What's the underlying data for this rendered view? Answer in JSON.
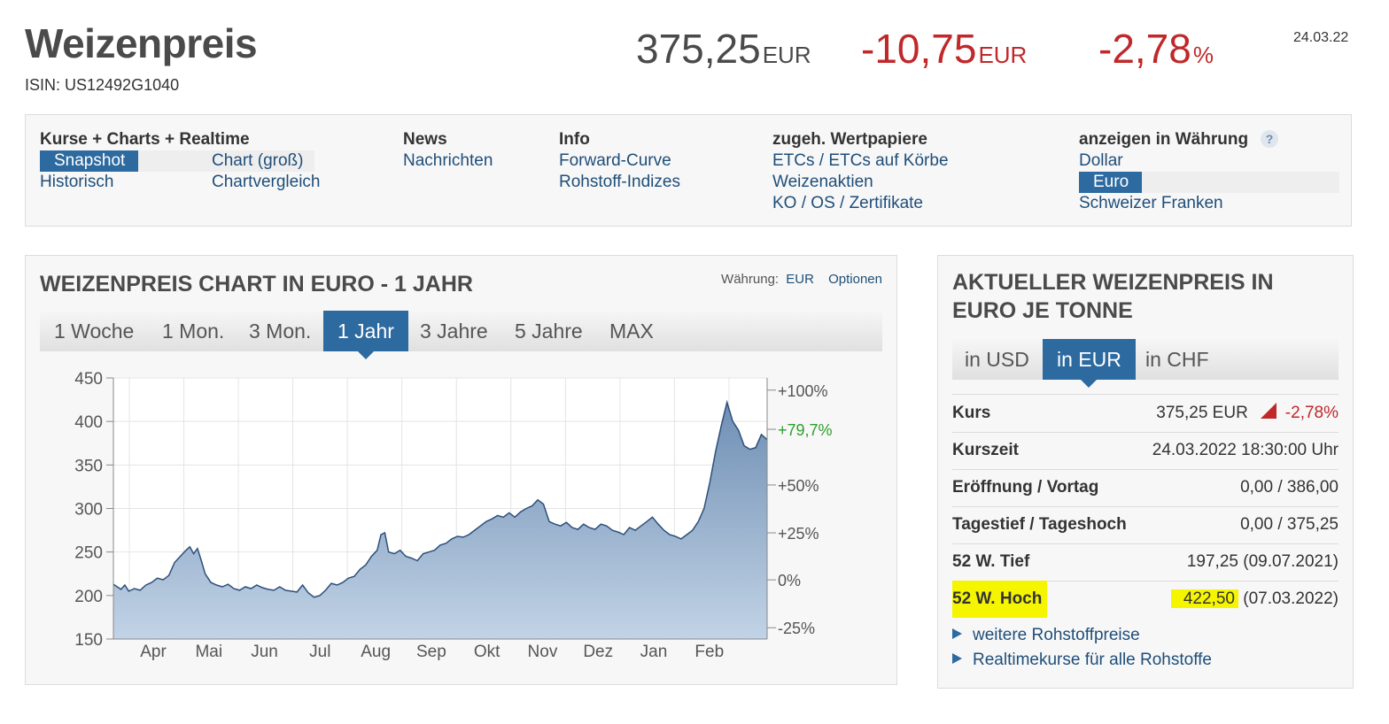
{
  "header": {
    "title": "Weizenpreis",
    "isin": "ISIN: US12492G1040",
    "price": "375,25",
    "price_unit": "EUR",
    "change_abs": "-10,75",
    "change_abs_unit": "EUR",
    "change_pct": "-2,78",
    "change_pct_unit": "%",
    "date": "24.03.22"
  },
  "nav": {
    "col1": {
      "heading": "Kurse + Charts + Realtime",
      "items": [
        "Snapshot",
        "Chart (groß)",
        "Historisch",
        "Chartvergleich"
      ]
    },
    "col2": {
      "heading": "News",
      "items": [
        "Nachrichten"
      ]
    },
    "col3": {
      "heading": "Info",
      "items": [
        "Forward-Curve",
        "Rohstoff-Indizes"
      ]
    },
    "col4": {
      "heading": "zugeh. Wertpapiere",
      "items": [
        "ETCs / ETCs auf Körbe",
        "Weizenaktien",
        "KO / OS / Zertifikate"
      ]
    },
    "col5": {
      "heading": "anzeigen in Währung",
      "help": "?",
      "items": [
        "Dollar",
        "Euro",
        "Schweizer Franken"
      ]
    }
  },
  "chart_panel": {
    "title": "WEIZENPREIS CHART IN EURO - 1 JAHR",
    "currency_label": "Währung:",
    "currency_value": "EUR",
    "options_label": "Optionen",
    "tabs": [
      "1 Woche",
      "1 Mon.",
      "3 Mon.",
      "1 Jahr",
      "3 Jahre",
      "5 Jahre",
      "MAX"
    ],
    "active_tab": "1 Jahr"
  },
  "chart_data": {
    "type": "area",
    "x_labels": [
      "Apr",
      "Mai",
      "Jun",
      "Jul",
      "Aug",
      "Sep",
      "Okt",
      "Nov",
      "Dez",
      "Jan",
      "Feb"
    ],
    "ylim": [
      150,
      450
    ],
    "yticks": [
      150,
      200,
      250,
      300,
      350,
      400,
      450
    ],
    "right_ticks": [
      {
        "label": "+100%",
        "value": 436
      },
      {
        "label": "+79,7%",
        "value": 391,
        "highlight": true
      },
      {
        "label": "+50%",
        "value": 327
      },
      {
        "label": "+25%",
        "value": 272
      },
      {
        "label": "0%",
        "value": 218
      },
      {
        "label": "-25%",
        "value": 163
      }
    ],
    "series": [
      {
        "x": [
          0,
          0.3,
          0.6,
          0.9,
          1.2,
          1.5,
          1.8,
          2.1,
          2.4,
          2.7,
          3.0,
          3.3,
          3.6,
          3.9,
          4.2,
          4.5,
          4.8,
          5.1,
          5.4,
          5.7,
          6.0,
          6.3,
          6.6,
          6.9,
          7.2,
          7.5,
          7.8,
          8.1,
          8.4,
          8.7,
          9.0,
          9.3,
          9.6,
          9.9,
          10.2,
          10.5,
          10.8,
          11.1,
          11.4,
          11.7,
          12.0
        ],
        "y": [
          213,
          205,
          212,
          222,
          232,
          256,
          238,
          215,
          212,
          208,
          210,
          209,
          207,
          206,
          205,
          198,
          210,
          215,
          223,
          235,
          265,
          248,
          250,
          238,
          245,
          258,
          267,
          278,
          282,
          290,
          288,
          300,
          290,
          283,
          280,
          286,
          279,
          275,
          283,
          290,
          276
        ]
      }
    ],
    "series_full": [
      [
        0.0,
        213
      ],
      [
        0.1,
        210
      ],
      [
        0.2,
        207
      ],
      [
        0.3,
        212
      ],
      [
        0.4,
        205
      ],
      [
        0.55,
        208
      ],
      [
        0.7,
        206
      ],
      [
        0.85,
        212
      ],
      [
        1.0,
        215
      ],
      [
        1.15,
        220
      ],
      [
        1.3,
        218
      ],
      [
        1.45,
        223
      ],
      [
        1.6,
        238
      ],
      [
        1.75,
        245
      ],
      [
        1.9,
        252
      ],
      [
        2.0,
        256
      ],
      [
        2.1,
        248
      ],
      [
        2.2,
        254
      ],
      [
        2.3,
        240
      ],
      [
        2.4,
        225
      ],
      [
        2.55,
        215
      ],
      [
        2.7,
        212
      ],
      [
        2.85,
        210
      ],
      [
        3.0,
        213
      ],
      [
        3.15,
        208
      ],
      [
        3.3,
        206
      ],
      [
        3.45,
        210
      ],
      [
        3.6,
        208
      ],
      [
        3.75,
        212
      ],
      [
        3.9,
        209
      ],
      [
        4.05,
        207
      ],
      [
        4.2,
        206
      ],
      [
        4.35,
        210
      ],
      [
        4.5,
        206
      ],
      [
        4.65,
        205
      ],
      [
        4.8,
        204
      ],
      [
        4.95,
        212
      ],
      [
        5.1,
        203
      ],
      [
        5.25,
        198
      ],
      [
        5.4,
        200
      ],
      [
        5.55,
        206
      ],
      [
        5.7,
        214
      ],
      [
        5.85,
        212
      ],
      [
        6.0,
        215
      ],
      [
        6.15,
        220
      ],
      [
        6.3,
        222
      ],
      [
        6.45,
        230
      ],
      [
        6.6,
        235
      ],
      [
        6.75,
        245
      ],
      [
        6.9,
        252
      ],
      [
        7.0,
        270
      ],
      [
        7.1,
        272
      ],
      [
        7.2,
        250
      ],
      [
        7.35,
        248
      ],
      [
        7.5,
        252
      ],
      [
        7.65,
        245
      ],
      [
        7.8,
        243
      ],
      [
        7.95,
        240
      ],
      [
        8.1,
        248
      ],
      [
        8.25,
        250
      ],
      [
        8.4,
        252
      ],
      [
        8.55,
        258
      ],
      [
        8.7,
        260
      ],
      [
        8.85,
        265
      ],
      [
        9.0,
        268
      ],
      [
        9.15,
        267
      ],
      [
        9.3,
        270
      ],
      [
        9.45,
        275
      ],
      [
        9.6,
        280
      ],
      [
        9.75,
        285
      ],
      [
        9.9,
        288
      ],
      [
        10.05,
        292
      ],
      [
        10.2,
        290
      ],
      [
        10.35,
        295
      ],
      [
        10.5,
        290
      ],
      [
        10.65,
        296
      ],
      [
        10.8,
        300
      ],
      [
        10.95,
        303
      ],
      [
        11.1,
        310
      ],
      [
        11.25,
        305
      ],
      [
        11.4,
        285
      ],
      [
        11.55,
        282
      ],
      [
        11.7,
        280
      ],
      [
        11.85,
        284
      ],
      [
        12.0,
        278
      ],
      [
        12.15,
        276
      ],
      [
        12.3,
        282
      ],
      [
        12.45,
        278
      ],
      [
        12.6,
        276
      ],
      [
        12.75,
        282
      ],
      [
        12.9,
        280
      ],
      [
        13.05,
        275
      ],
      [
        13.2,
        273
      ],
      [
        13.35,
        270
      ],
      [
        13.5,
        278
      ],
      [
        13.65,
        275
      ],
      [
        13.8,
        280
      ],
      [
        13.95,
        285
      ],
      [
        14.1,
        290
      ],
      [
        14.25,
        282
      ],
      [
        14.4,
        275
      ],
      [
        14.55,
        270
      ],
      [
        14.7,
        268
      ],
      [
        14.85,
        265
      ],
      [
        15.0,
        270
      ],
      [
        15.15,
        275
      ],
      [
        15.3,
        285
      ],
      [
        15.45,
        300
      ],
      [
        15.6,
        330
      ],
      [
        15.75,
        365
      ],
      [
        15.9,
        395
      ],
      [
        16.05,
        422
      ],
      [
        16.2,
        400
      ],
      [
        16.35,
        390
      ],
      [
        16.5,
        372
      ],
      [
        16.65,
        368
      ],
      [
        16.8,
        370
      ],
      [
        16.95,
        385
      ],
      [
        17.1,
        379
      ]
    ]
  },
  "info_panel": {
    "title": "AKTUELLER WEIZENPREIS IN EURO JE TONNE",
    "tabs": [
      "in USD",
      "in EUR",
      "in CHF"
    ],
    "active_tab": "in EUR",
    "rows": [
      {
        "label": "Kurs",
        "value": "375,25 EUR",
        "extra": "-2,78%"
      },
      {
        "label": "Kurszeit",
        "value": "24.03.2022 18:30:00 Uhr"
      },
      {
        "label": "Eröffnung / Vortag",
        "value": "0,00 / 386,00"
      },
      {
        "label": "Tagestief / Tageshoch",
        "value": "0,00 / 375,25"
      },
      {
        "label": "52 W. Tief",
        "value": "197,25 (09.07.2021)"
      },
      {
        "label": "52 W. Hoch",
        "value_main": "422,50",
        "value_rest": " (07.03.2022)"
      }
    ],
    "links": [
      "weitere Rohstoffpreise",
      "Realtimekurse für alle Rohstoffe"
    ]
  },
  "colors": {
    "accent": "#2d6aa0",
    "negative": "#c0282a",
    "positive": "#2e9e2e",
    "highlight": "#f5f500",
    "area_fill_top": "#6f8fb4",
    "area_fill_bottom": "#c2d3e6",
    "line": "#2d4f7a"
  }
}
